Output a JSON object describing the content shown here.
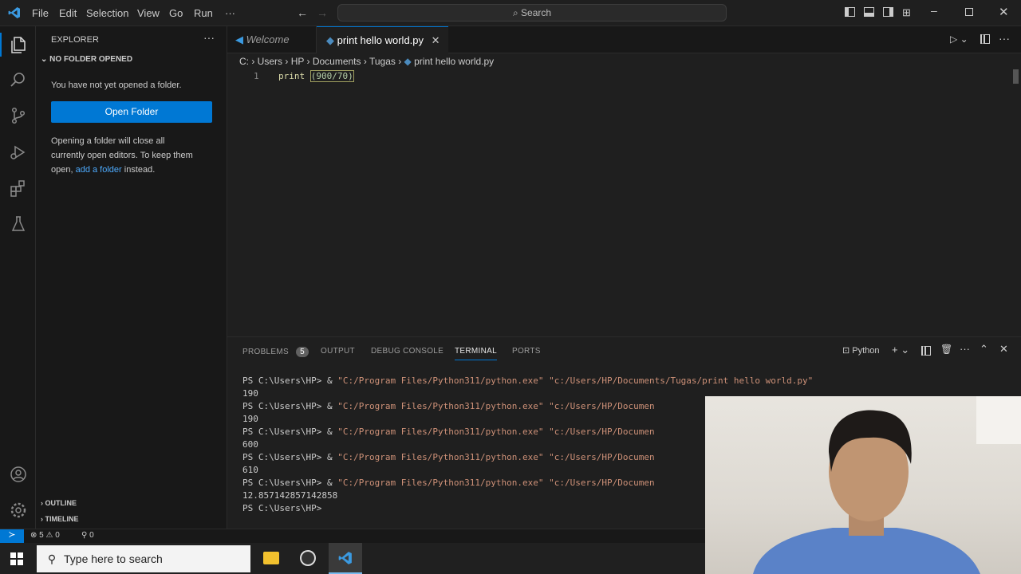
{
  "menu": [
    "File",
    "Edit",
    "Selection",
    "View",
    "Go",
    "Run",
    "···"
  ],
  "search": {
    "label": "Search"
  },
  "sidebar": {
    "title": "EXPLORER",
    "section": "NO FOLDER OPENED",
    "no_folder_text": "You have not yet opened a folder.",
    "open_folder_label": "Open Folder",
    "info_text_1": "Opening a folder will close all",
    "info_text_2": "currently open editors. To keep them",
    "info_text_3": "open,",
    "add_folder_link": "add a folder",
    "info_text_4": "instead.",
    "outline": "OUTLINE",
    "timeline": "TIMELINE"
  },
  "tabs": [
    {
      "label": "Welcome"
    },
    {
      "label": "print hello world.py"
    }
  ],
  "breadcrumb": [
    "C:",
    "Users",
    "HP",
    "Documents",
    "Tugas",
    "print hello world.py"
  ],
  "editor": {
    "line_number": "1",
    "code_keyword": "print",
    "code_args": "(900/70)"
  },
  "panel": {
    "tabs": [
      "PROBLEMS",
      "OUTPUT",
      "DEBUG CONSOLE",
      "TERMINAL",
      "PORTS"
    ],
    "problems_count": "5",
    "shell": "Python",
    "terminal_lines": [
      {
        "prompt": "PS C:\\Users\\HP> & ",
        "exe": "\"C:/Program Files/Python311/python.exe\"",
        "script": " \"c:/Users/HP/Documents/Tugas/print hello world.py\""
      },
      {
        "output": "190"
      },
      {
        "prompt": "PS C:\\Users\\HP> & ",
        "exe": "\"C:/Program Files/Python311/python.exe\"",
        "script": " \"c:/Users/HP/Documen"
      },
      {
        "output": "190"
      },
      {
        "prompt": "PS C:\\Users\\HP> & ",
        "exe": "\"C:/Program Files/Python311/python.exe\"",
        "script": " \"c:/Users/HP/Documen"
      },
      {
        "output": "600"
      },
      {
        "prompt": "PS C:\\Users\\HP> & ",
        "exe": "\"C:/Program Files/Python311/python.exe\"",
        "script": " \"c:/Users/HP/Documen"
      },
      {
        "output": "610"
      },
      {
        "prompt": "PS C:\\Users\\HP> & ",
        "exe": "\"C:/Program Files/Python311/python.exe\"",
        "script": " \"c:/Users/HP/Documen"
      },
      {
        "output": "12.857142857142858"
      },
      {
        "prompt": "PS C:\\Users\\HP>",
        "exe": "",
        "script": ""
      }
    ]
  },
  "statusbar": {
    "errors": "5",
    "warnings": "0",
    "ports": "0"
  },
  "taskbar": {
    "search_placeholder": "Type here to search"
  },
  "colors": {
    "accent": "#0078d4",
    "string": "#ce9178",
    "keyword": "#dcdcaa"
  }
}
